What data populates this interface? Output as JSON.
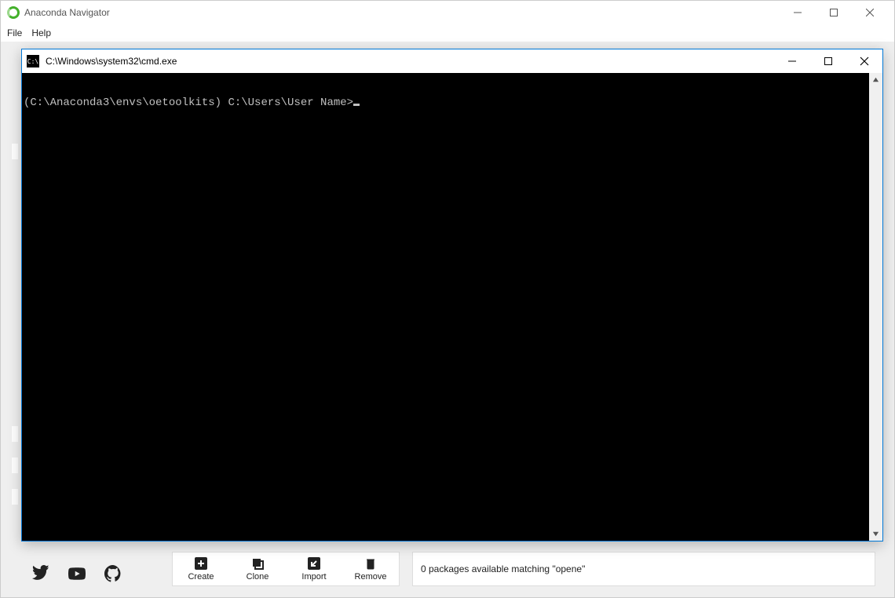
{
  "navigator": {
    "title": "Anaconda Navigator",
    "menu": {
      "file": "File",
      "help": "Help"
    },
    "toolbar": {
      "create": "Create",
      "clone": "Clone",
      "import": "Import",
      "remove": "Remove"
    },
    "status": "0 packages available matching \"opene\""
  },
  "cmd": {
    "title": "C:\\Windows\\system32\\cmd.exe",
    "prompt": "(C:\\Anaconda3\\envs\\oetoolkits) C:\\Users\\User Name>"
  }
}
